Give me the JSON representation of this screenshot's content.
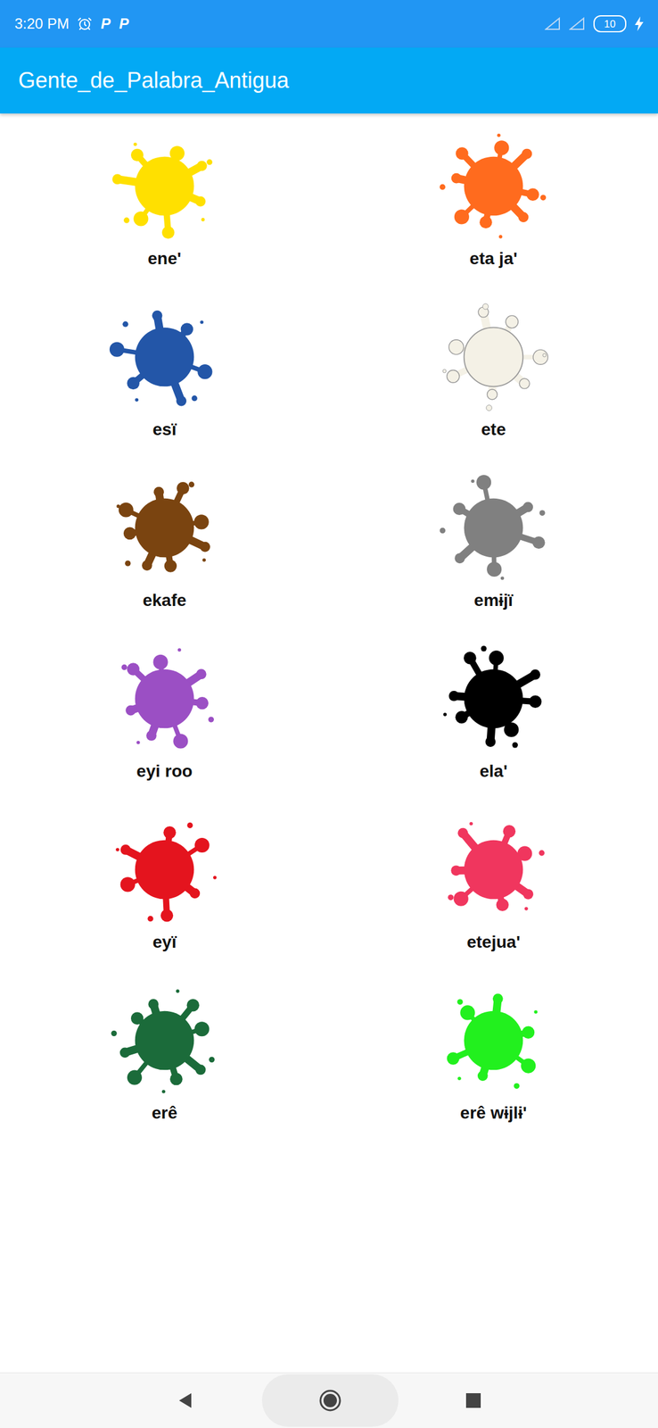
{
  "status_bar": {
    "time": "3:20 PM",
    "notifications": [
      "P",
      "P"
    ],
    "battery": "10",
    "charging": true
  },
  "app_bar": {
    "title": "Gente_de_Palabra_Antigua"
  },
  "colors": [
    {
      "label": "ene'",
      "color": "#FFE000"
    },
    {
      "label": "eta ja'",
      "color": "#FF6B1E"
    },
    {
      "label": "esï",
      "color": "#2356A8"
    },
    {
      "label": "ete",
      "color": "#F4F1E6"
    },
    {
      "label": "ekafe",
      "color": "#7A4410"
    },
    {
      "label": "emɨjï",
      "color": "#808080"
    },
    {
      "label": "eyi roo",
      "color": "#9B4FC4"
    },
    {
      "label": "ela'",
      "color": "#000000"
    },
    {
      "label": "eyï",
      "color": "#E4141E"
    },
    {
      "label": "etejua'",
      "color": "#F0365E"
    },
    {
      "label": "erê",
      "color": "#1B6B3A"
    },
    {
      "label": "erê wɨjlɨ'",
      "color": "#22F01E"
    }
  ]
}
